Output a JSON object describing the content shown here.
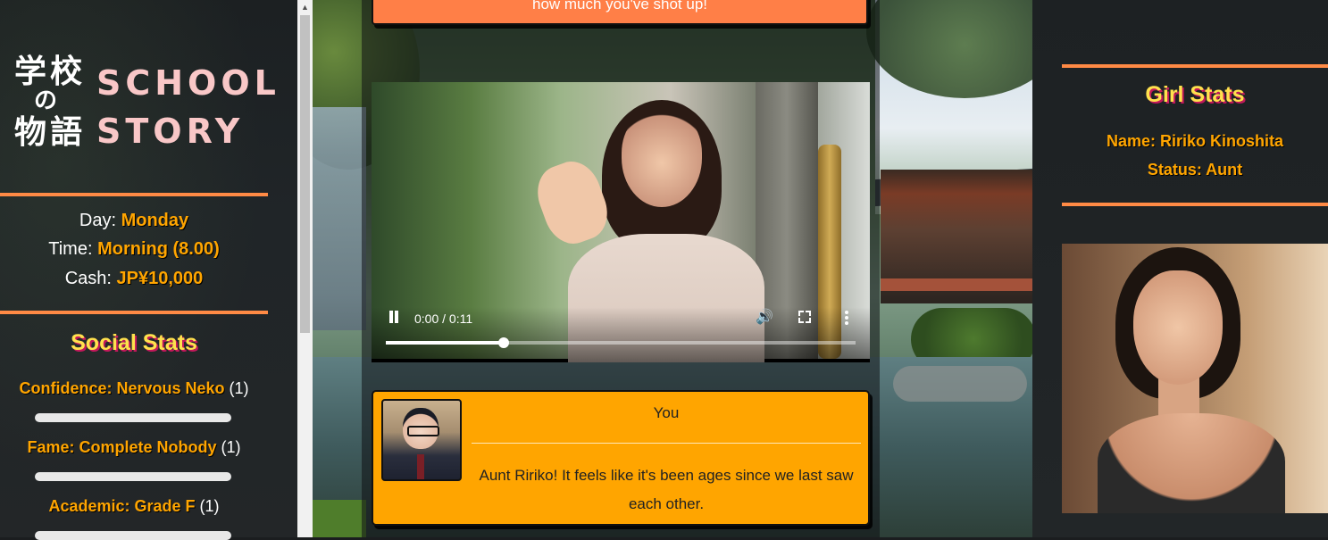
{
  "logo": {
    "kanji": [
      "学",
      "校",
      "の",
      "物",
      "語"
    ],
    "title_line1": "SCHOOL",
    "title_line2": "STORY"
  },
  "status": {
    "day_label": "Day:",
    "day_value": "Monday",
    "time_label": "Time:",
    "time_value": "Morning (8.00)",
    "cash_label": "Cash:",
    "cash_value": "JP¥10,000"
  },
  "social_stats": {
    "title": "Social Stats",
    "items": [
      {
        "label": "Confidence: Nervous Neko",
        "level": "(1)",
        "progress": 0
      },
      {
        "label": "Fame: Complete Nobody",
        "level": "(1)",
        "progress": 0
      },
      {
        "label": "Academic: Grade F",
        "level": "(1)",
        "progress": 0
      }
    ]
  },
  "story": {
    "previous_line": "how much you've shot up!",
    "video": {
      "time": "0:00 / 0:11",
      "progress": 0.25
    },
    "dialog": {
      "speaker": "You",
      "text": "Aunt Ririko! It feels like it's been ages since we last saw each other."
    }
  },
  "girl_stats": {
    "title": "Girl Stats",
    "name": "Name: Ririko Kinoshita",
    "status": "Status: Aunt"
  },
  "colors": {
    "accent": "#ff8a45",
    "highlight": "#ffa500",
    "title_yellow": "#ffe14d",
    "title_shadow": "#c2185b",
    "dialog_bg": "#ffa500",
    "prev_card_bg": "#ff7f47"
  },
  "icons": [
    "pause-icon",
    "volume-icon",
    "fullscreen-icon",
    "more-options-icon",
    "scroll-up-arrow-icon"
  ]
}
